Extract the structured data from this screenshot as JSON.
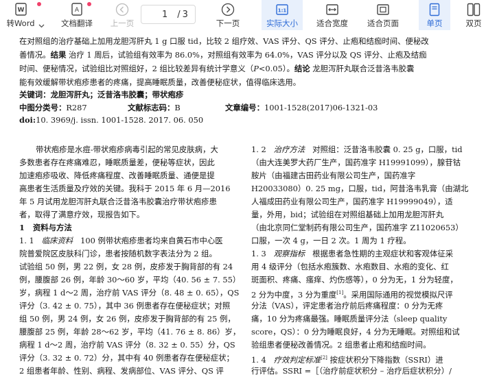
{
  "toolbar": {
    "word_label": "转Word",
    "translate_label": "文档翻译",
    "prev_label": "上一页",
    "page_current": "1",
    "page_separator": "/",
    "page_total": "3",
    "next_label": "下一页",
    "actual_size_label": "实际大小",
    "fit_width_label": "适合宽度",
    "fit_page_label": "适合页面",
    "single_page_label": "单页",
    "double_page_label": "双页",
    "accent_color": "#2d6bd6",
    "badge_color": "#f0416b"
  },
  "abstract": {
    "line1": "在对照组的治疗基础上加用龙胆泻肝丸 1 g 口服 tid，比较 2 组疗效、VAS 评分、QS 评分、止疱和结痂时间、便秘改",
    "line2a": "善情况。",
    "line2_result_label": "结果",
    "line2b": "  治疗 1 周后，试验组有效率为 86.0%，对照组有效率为 64.0%，VAS 评分以及 QS 评分、止疱及结痂",
    "line3a": "时间、便秘情况，试验组比对照组好，2 组比较差异有统计学意义（",
    "line3_p": "P",
    "line3b": "<0.05）。",
    "line3_conclusion_label": "结论",
    "line3c": "  龙胆泻肝丸联合泛昔洛韦胶囊",
    "line4": "能有效缓解带状疱疹患者的疼痛，提高睡眠质量，改善便秘症状，值得临床选用。"
  },
  "meta": {
    "keywords_label": "关键词：",
    "keywords_value": "龙胆泻肝丸；泛昔洛韦胶囊；带状疱疹",
    "clc_label": "中图分类号：",
    "clc_value": "R287",
    "doc_code_label": "文献标志码：",
    "doc_code_value": "B",
    "article_no_label": "文章编号：",
    "article_no_value": "1001-1528(2017)06-1321-03",
    "doi_label": "doi:",
    "doi_value": "10. 3969/j. issn. 1001-1528. 2017. 06. 050"
  },
  "left_col": {
    "p1": [
      "带状疱疹是水痘-带状疱疹病毒引起的常见皮肤病，大",
      "多数患者存在疼痛难忍，睡眠质量差，便秘等症状，因此",
      "加速疱疹吸收、降低疼痛程度、改善睡眠质量、通便是提",
      "高患者生活质量及疗效的关键。我科于 2015 年 6 月—2016",
      "年 5 月试用龙胆泻肝丸联合泛昔洛韦胶囊治疗带状疱疹患",
      "者，取得了满意疗效，现报告如下。"
    ],
    "section1_num": "1",
    "section1_title": "资料与方法",
    "s11_num": "1. 1",
    "s11_title": "临床资料",
    "s11_lines": [
      "100 例带状疱疹患者均来自黄石市中心医",
      "院普爱院区皮肤科门诊，患者按随机数字表法分为 2 组。",
      "试验组 50 例，男 22 例，女 28 例，皮疹发于胸背部的有 24",
      "例，腰腹部 26 例，年龄 30～60 岁，平均（40. 56 ± 7. 55）",
      "岁，病程 1 d～2 周，治疗前 VAS 评分（8. 48 ± 0. 65），QS",
      "评分（3. 42 ± 0. 75），其中 36 例患者存在便秘症状；对照",
      "组 50 例，男 24 例，女 26 例，皮疹发于胸背部的有 25 例，",
      "腰腹部 25 例，年龄 28～62 岁，平均（41. 76 ± 8. 86）岁，",
      "病程 1 d～2 周，治疗前 VAS 评分（8. 32 ± 0. 55）分，QS",
      "评分（3. 32 ± 0. 72）分，其中有 40 例患者存在便秘症状；",
      "2 组患者年龄、性别、病程、发病部位、VAS 评分、QS 评"
    ]
  },
  "right_col": {
    "s12_num": "1. 2",
    "s12_title": "治疗方法",
    "s12_lines": [
      "对照组：泛昔洛韦胶囊 0. 25 g，口服，tid",
      "（由大连美罗大药厂生产，国药准字 H19991099），腺苷钴",
      "胺片（由福建古田药业有限公司生产，国药准字",
      "H20033080）0. 25 mg，口服，tid，阿昔洛韦乳膏（由湖北",
      "人福成田药业有限公司生产，国药准字 H19999049），适",
      "量，外用，bid；试验组在对照组基础上加用龙胆泻肝丸",
      "（由北京同仁堂制药有限公司生产，国药准字 Z11020653）",
      "口服，一次 4 g，一日 2 次。1 周为 1 疗程。"
    ],
    "s13_num": "1. 3",
    "s13_title": "观察指标",
    "s13_lines": [
      "根据患者急性期的主观症状和客观体征采",
      "用 4 级评分（包括水疱簇数、水疱数目、水疱的变化、红",
      "斑面积、疼痛、瘙痒、灼伤感等），0 分为无，1 分为轻度，"
    ],
    "s13_line4a": "2 分为中度，3 分为重度",
    "s13_line4_ref": "[1]",
    "s13_line4b": "。采用国际通用的视觉模拟尺评",
    "s13_lines_b": [
      "分法（VAS），评定患者治疗前后疼痛程度：0 分为无疼",
      "痛，10 分为疼痛最强。睡眠质量评分法（sleep quality",
      "score，QS）：0 分为睡眠良好，4 分为无睡眠。对照组和试",
      "验组患者便秘改善情况。2 组患者止疱和结痂时间。"
    ],
    "s14_num": "1. 4",
    "s14_title": "疗效判定标准",
    "s14_ref": "[2]",
    "s14_line1": "  按症状积分下降指数（SSRI）进",
    "s14_line2": "行评估。SSRI =［（治疗前症状积分 – 治疗后症状积分）/"
  }
}
